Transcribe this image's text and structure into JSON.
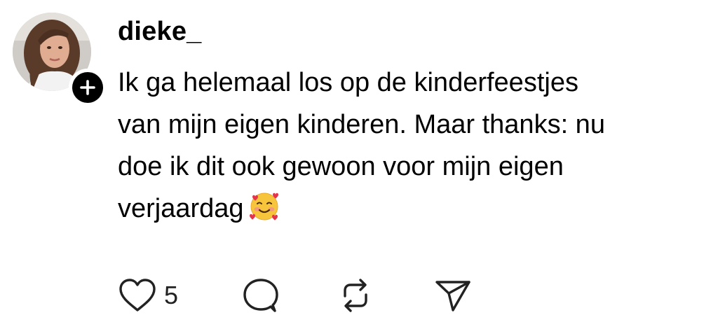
{
  "post": {
    "username": "dieke_",
    "text": "Ik ga helemaal los op de kinderfeestjes\nvan mijn eigen kinderen. Maar thanks: nu\ndoe ik dit ook gewoon voor mijn eigen\nverjaardag",
    "emoji": "smiling-face-with-hearts",
    "avatar": {
      "follow_badge_icon": "plus-icon",
      "badge_color": "#000000"
    }
  },
  "actions": {
    "like": {
      "icon": "heart-outline-icon",
      "count": "5"
    },
    "reply": {
      "icon": "speech-bubble-icon"
    },
    "repost": {
      "icon": "repost-icon"
    },
    "share": {
      "icon": "paper-plane-icon"
    }
  },
  "colors": {
    "background": "#ffffff",
    "text": "#000000",
    "icon_stroke": "#222222"
  }
}
